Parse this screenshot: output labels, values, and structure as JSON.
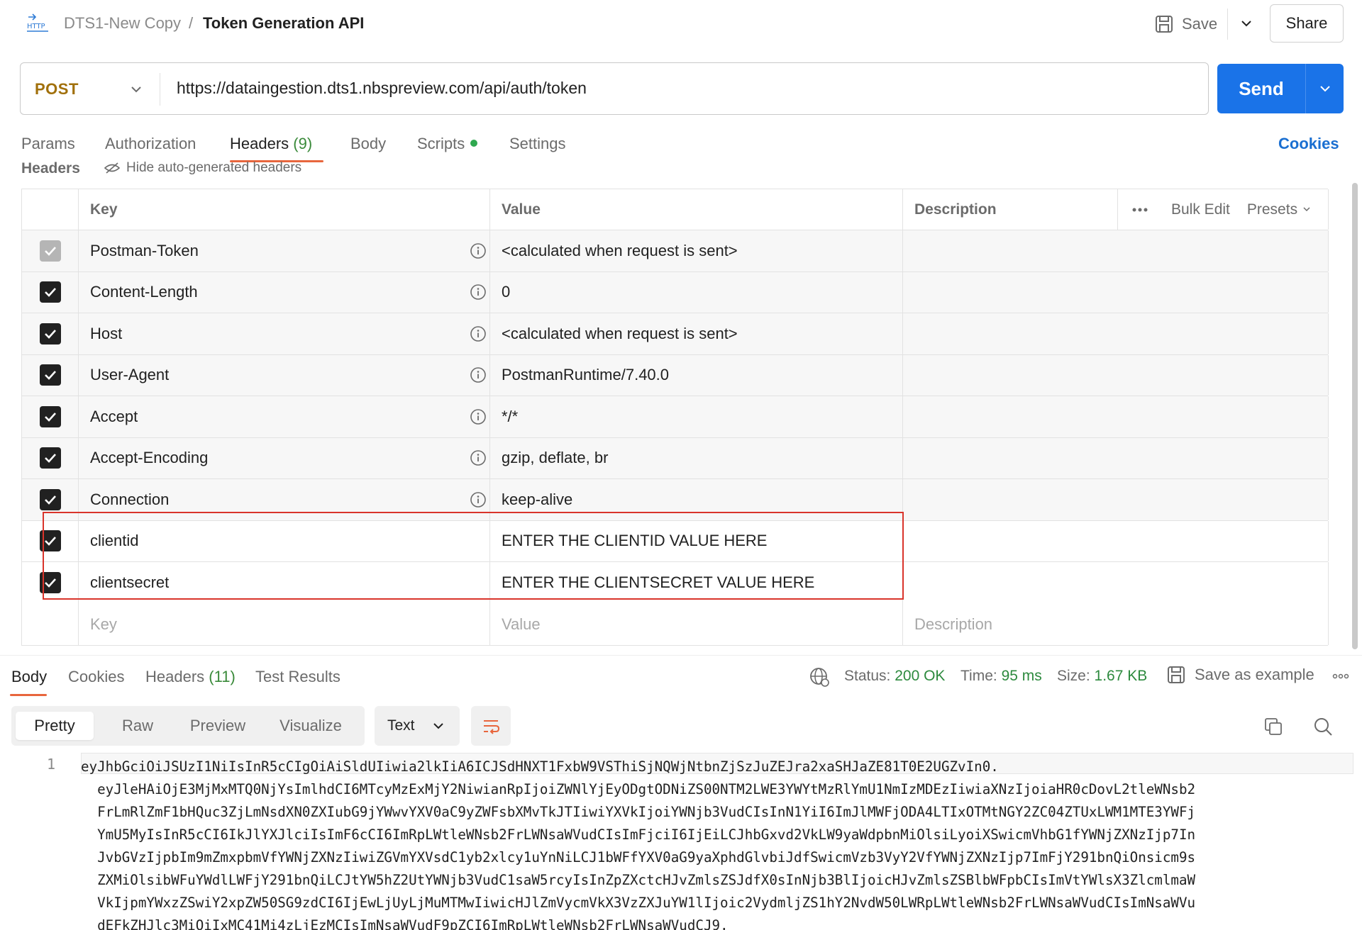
{
  "breadcrumb": {
    "collection": "DTS1-New Copy",
    "separator": "/",
    "request_name": "Token Generation API"
  },
  "top_actions": {
    "save_label": "Save",
    "share_label": "Share"
  },
  "request": {
    "method": "POST",
    "url": "https://dataingestion.dts1.nbspreview.com/api/auth/token",
    "send_label": "Send"
  },
  "request_tabs": {
    "params": "Params",
    "authorization": "Authorization",
    "headers": "Headers",
    "headers_count": "(9)",
    "body": "Body",
    "scripts": "Scripts",
    "settings": "Settings",
    "cookies": "Cookies"
  },
  "headers_section": {
    "title": "Headers",
    "hide_auto_label": "Hide auto-generated headers"
  },
  "headers_table": {
    "columns": {
      "key": "Key",
      "value": "Value",
      "description": "Description"
    },
    "tools": {
      "bulk_edit": "Bulk Edit",
      "presets": "Presets"
    },
    "rows": [
      {
        "key": "Postman-Token",
        "value": "<calculated when request is sent>",
        "checked": true,
        "auto": true,
        "locked": true
      },
      {
        "key": "Content-Length",
        "value": "0",
        "checked": true,
        "auto": true
      },
      {
        "key": "Host",
        "value": "<calculated when request is sent>",
        "checked": true,
        "auto": true
      },
      {
        "key": "User-Agent",
        "value": "PostmanRuntime/7.40.0",
        "checked": true,
        "auto": true
      },
      {
        "key": "Accept",
        "value": "*/*",
        "checked": true,
        "auto": true
      },
      {
        "key": "Accept-Encoding",
        "value": "gzip, deflate, br",
        "checked": true,
        "auto": true
      },
      {
        "key": "Connection",
        "value": "keep-alive",
        "checked": true,
        "auto": true
      },
      {
        "key": "clientid",
        "value": "ENTER THE CLIENTID VALUE HERE",
        "checked": true,
        "auto": false
      },
      {
        "key": "clientsecret",
        "value": "ENTER THE CLIENTSECRET VALUE HERE",
        "checked": true,
        "auto": false
      }
    ],
    "new_row": {
      "key": "Key",
      "value": "Value",
      "description": "Description"
    }
  },
  "response": {
    "tabs": {
      "body": "Body",
      "cookies": "Cookies",
      "headers": "Headers",
      "headers_count": "(11)",
      "test_results": "Test Results"
    },
    "status_label": "Status:",
    "status_value": "200 OK",
    "time_label": "Time:",
    "time_value": "95 ms",
    "size_label": "Size:",
    "size_value": "1.67 KB",
    "save_example_label": "Save as example",
    "view_modes": {
      "pretty": "Pretty",
      "raw": "Raw",
      "preview": "Preview",
      "visualize": "Visualize"
    },
    "format": "Text",
    "line_number": "1",
    "body_lines": [
      "eyJhbGciOiJSUzI1NiIsInR5cCIgOiAiSldUIiwia2lkIiA6ICJSdHNXT1FxbW9VSThiSjNQWjNtbnZjSzJuZEJra2xaSHJaZE81T0E2UGZvIn0.",
      "  eyJleHAiOjE3MjMxMTQ0NjYsImlhdCI6MTcyMzExMjY2NiwianRpIjoiZWNlYjEyODgtODNiZS00NTM2LWE3YWYtMzRlYmU1NmIzMDEzIiwiaXNzIjoiaHR0cDovL2tleWNsb2",
      "  FrLmRlZmF1bHQuc3ZjLmNsdXN0ZXIubG9jYWwvYXV0aC9yZWFsbXMvTkJTIiwiYXVkIjoiYWNjb3VudCIsInN1YiI6ImJlMWFjODA4LTIxOTMtNGY2ZC04ZTUxLWM1MTE3YWFj",
      "  YmU5MyIsInR5cCI6IkJlYXJlciIsImF6cCI6ImRpLWtleWNsb2FrLWNsaWVudCIsImFjciI6IjEiLCJhbGxvd2VkLW9yaWdpbnMiOlsiLyoiXSwicmVhbG1fYWNjZXNzIjp7In",
      "  JvbGVzIjpbIm9mZmxpbmVfYWNjZXNzIiwiZGVmYXVsdC1yb2xlcy1uYnNiLCJ1bWFfYXV0aG9yaXphdGlvbiJdfSwicmVzb3VyY2VfYWNjZXNzIjp7ImFjY291bnQiOnsicm9s",
      "  ZXMiOlsibWFuYWdlLWFjY291bnQiLCJtYW5hZ2UtYWNjb3VudC1saW5rcyIsInZpZXctcHJvZmlsZSJdfX0sInNjb3BlIjoicHJvZmlsZSBlbWFpbCIsImVtYWlsX3ZlcmlmaW",
      "  VkIjpmYWxzZSwiY2xpZW50SG9zdCI6IjEwLjUyLjMuMTMwIiwicHJlZmVycmVkX3VzZXJuYW1lIjoic2VydmljZS1hY2NvdW50LWRpLWtleWNsb2FrLWNsaWVudCIsImNsaWVu",
      "  dEFkZHJlc3MiOiIxMC41Mi4zLjEzMCIsImNsaWVudF9pZCI6ImRpLWtleWNsb2FrLWNsaWVudCJ9."
    ]
  }
}
